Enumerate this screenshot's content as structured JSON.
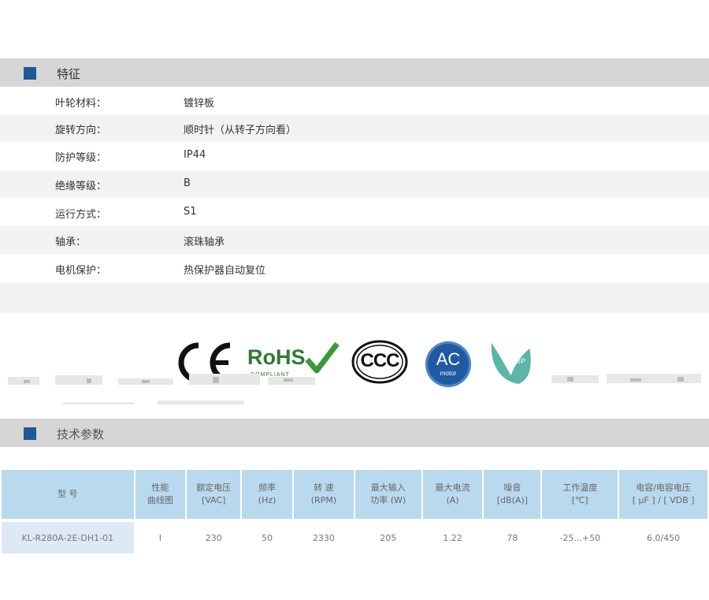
{
  "features": {
    "title": "特征",
    "rows": [
      {
        "label": "叶轮材料：",
        "value": "镀锌板"
      },
      {
        "label": "旋转方向：",
        "value": "顺时针（从转子方向看）"
      },
      {
        "label": "防护等级：",
        "value": "IP44"
      },
      {
        "label": "绝缘等级：",
        "value": "B"
      },
      {
        "label": "运行方式：",
        "value": "S1"
      },
      {
        "label": "轴承：",
        "value": "滚珠轴承"
      },
      {
        "label": "电机保护：",
        "value": "热保护器自动复位"
      }
    ]
  },
  "certifications": {
    "ce": "CE",
    "rohs": "RoHS",
    "rohs_sub": "COMPLIANT",
    "ccc": "CCC",
    "ac": "AC",
    "ac_sub": "motor",
    "erp": "ErP"
  },
  "specs": {
    "title": "技术参数",
    "headers": [
      [
        "型 号"
      ],
      [
        "性能",
        "曲线图"
      ],
      [
        "额定电压",
        "[VAC]"
      ],
      [
        "频率",
        "(Hz)"
      ],
      [
        "转 速",
        "(RPM)"
      ],
      [
        "最大输入",
        "功率 (W)"
      ],
      [
        "最大电流",
        "(A)"
      ],
      [
        "噪音",
        "[dB(A)]"
      ],
      [
        "工作温度",
        "[℃]"
      ],
      [
        "电容/电容电压",
        "[ μF ] / [ VDB ]"
      ]
    ],
    "rows": [
      [
        "KL-R280A-2E-DH1-01",
        "I",
        "230",
        "50",
        "2330",
        "205",
        "1.22",
        "78",
        "-25...+50",
        "6.0/450"
      ]
    ]
  }
}
